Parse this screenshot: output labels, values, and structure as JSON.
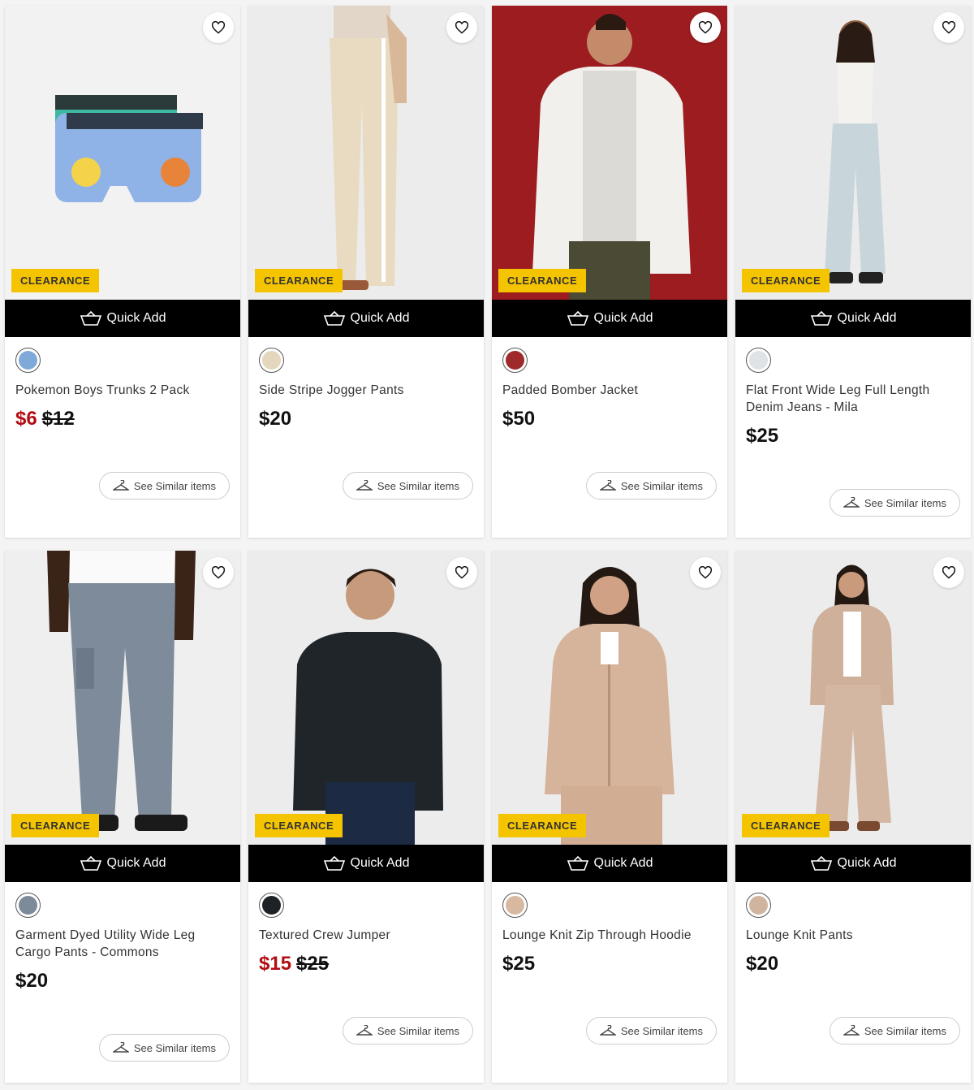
{
  "labels": {
    "badge": "CLEARANCE",
    "quick_add": "Quick Add",
    "see_similar": "See Similar items"
  },
  "icons": {
    "wishlist": "heart-icon",
    "quick_add": "basket-icon",
    "see_similar": "hanger-icon"
  },
  "colors": {
    "badge_bg": "#f5c400",
    "quick_add_bg": "#000000",
    "sale_price": "#b30d12"
  },
  "products": [
    {
      "name": "Pokemon Boys Trunks 2 Pack",
      "sale_price": "$6",
      "price": "$12",
      "swatch": "#7fa9d8"
    },
    {
      "name": "Side Stripe Jogger Pants",
      "price": "$20",
      "swatch": "#e5d7bd"
    },
    {
      "name": "Padded Bomber Jacket",
      "price": "$50",
      "swatch": "#9e2a2a"
    },
    {
      "name": "Flat Front Wide Leg Full Length Denim Jeans - Mila",
      "price": "$25",
      "swatch": "#dde3e6"
    },
    {
      "name": "Garment Dyed Utility Wide Leg Cargo Pants - Commons",
      "price": "$20",
      "swatch": "#7d8a99"
    },
    {
      "name": "Textured Crew Jumper",
      "sale_price": "$15",
      "price": "$25",
      "swatch": "#1e2226"
    },
    {
      "name": "Lounge Knit Zip Through Hoodie",
      "price": "$25",
      "swatch": "#d8b8a0"
    },
    {
      "name": "Lounge Knit Pants",
      "price": "$20",
      "swatch": "#cfb5a0"
    }
  ]
}
